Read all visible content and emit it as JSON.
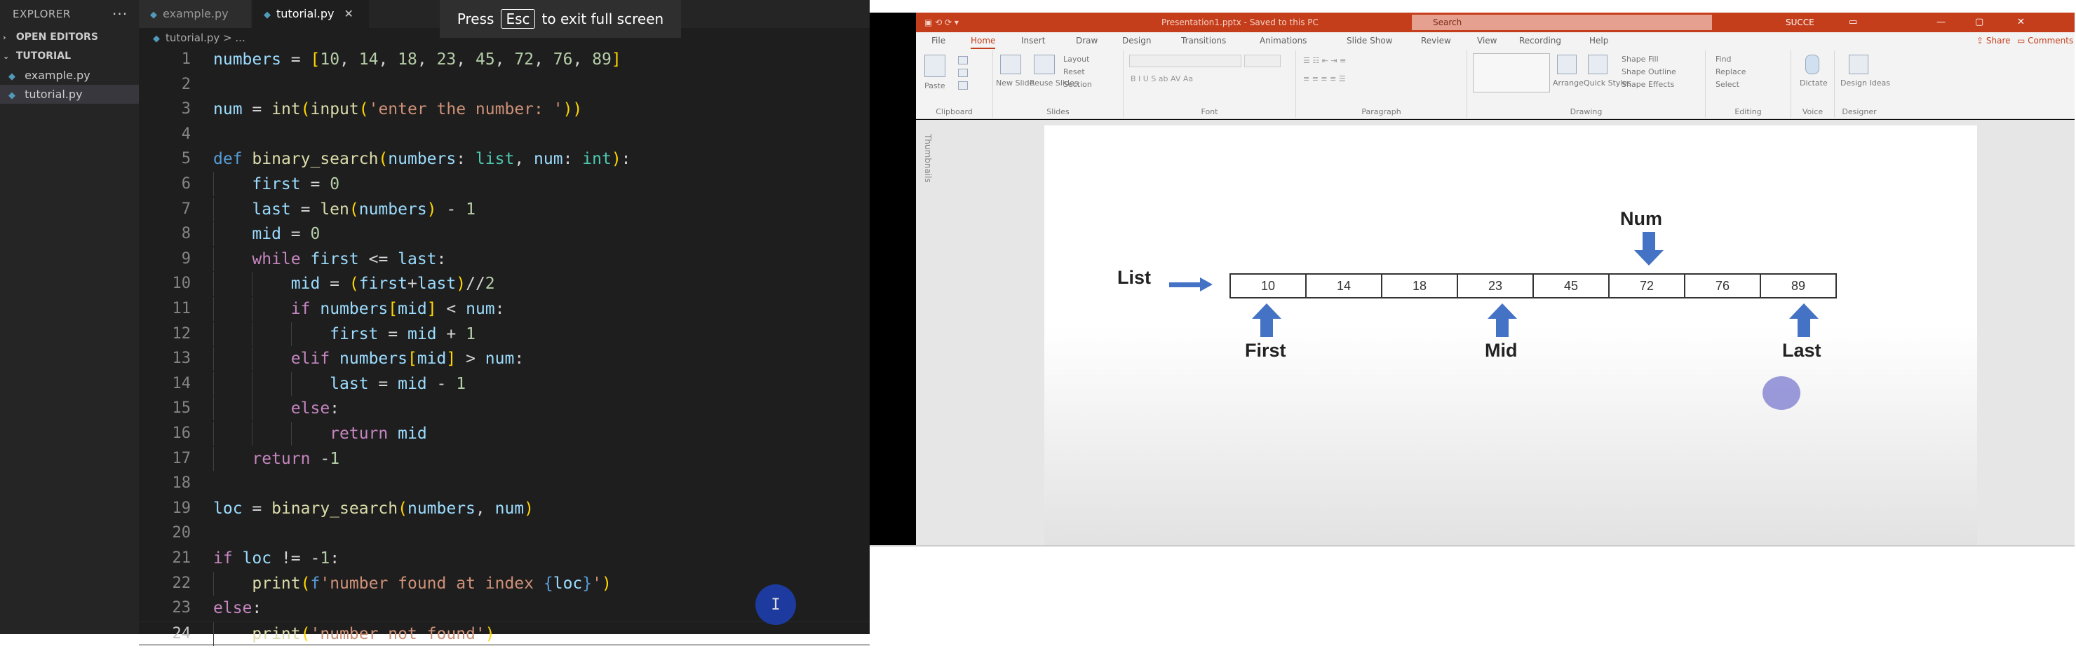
{
  "vscode": {
    "sidebar": {
      "title": "EXPLORER",
      "more": "···",
      "open_editors": "OPEN EDITORS",
      "folder": "TUTORIAL",
      "files": [
        "example.py",
        "tutorial.py"
      ]
    },
    "tabs": [
      {
        "label": "example.py",
        "active": false
      },
      {
        "label": "tutorial.py",
        "active": true,
        "close": "✕"
      }
    ],
    "breadcrumb": "tutorial.py > ...",
    "fullscreen_toast": {
      "prefix": "Press",
      "key": "Esc",
      "suffix": "to exit full screen"
    },
    "code_lines": [
      "numbers = [10, 14, 18, 23, 45, 72, 76, 89]",
      "",
      "num = int(input('enter the number: '))",
      "",
      "def binary_search(numbers: list, num: int):",
      "    first = 0",
      "    last = len(numbers) - 1",
      "    mid = 0",
      "    while first <= last:",
      "        mid = (first+last)//2",
      "        if numbers[mid] < num:",
      "            first = mid + 1",
      "        elif numbers[mid] > num:",
      "            last = mid - 1",
      "        else:",
      "            return mid",
      "    return -1",
      "",
      "loc = binary_search(numbers, num)",
      "",
      "if loc != -1:",
      "    print(f'number found at index {loc}')",
      "else:",
      "    print('number not found')"
    ],
    "current_line": 24,
    "cursor_glyph": "I"
  },
  "powerpoint": {
    "title": "Presentation1.pptx - Saved to this PC",
    "search_placeholder": "Search",
    "user": "SUCCE",
    "ribbon_tabs": [
      "File",
      "Home",
      "Insert",
      "Draw",
      "Design",
      "Transitions",
      "Animations",
      "Slide Show",
      "Review",
      "View",
      "Recording",
      "Help"
    ],
    "active_tab": "Home",
    "share_label": "Share",
    "comments_label": "Comments",
    "ribbon_groups": [
      "Clipboard",
      "Slides",
      "Font",
      "Paragraph",
      "Drawing",
      "Editing",
      "Voice",
      "Designer"
    ],
    "ribbon_buttons": {
      "paste": "Paste",
      "new_slide": "New Slide",
      "reuse_slides": "Reuse Slides",
      "layout": "Layout",
      "reset": "Reset",
      "section": "Section",
      "arrange": "Arrange",
      "quick_styles": "Quick Styles",
      "shape_fill": "Shape Fill",
      "shape_outline": "Shape Outline",
      "shape_effects": "Shape Effects",
      "find": "Find",
      "replace": "Replace",
      "select": "Select",
      "dictate": "Dictate",
      "designer": "Design Ideas"
    },
    "thumbnails_label": "Thumbnails",
    "slide": {
      "list_label": "List",
      "num_label": "Num",
      "first_label": "First",
      "mid_label": "Mid",
      "last_label": "Last",
      "cells": [
        "10",
        "14",
        "18",
        "23",
        "45",
        "72",
        "76",
        "89"
      ],
      "arrow_color": "#4472c4"
    }
  }
}
